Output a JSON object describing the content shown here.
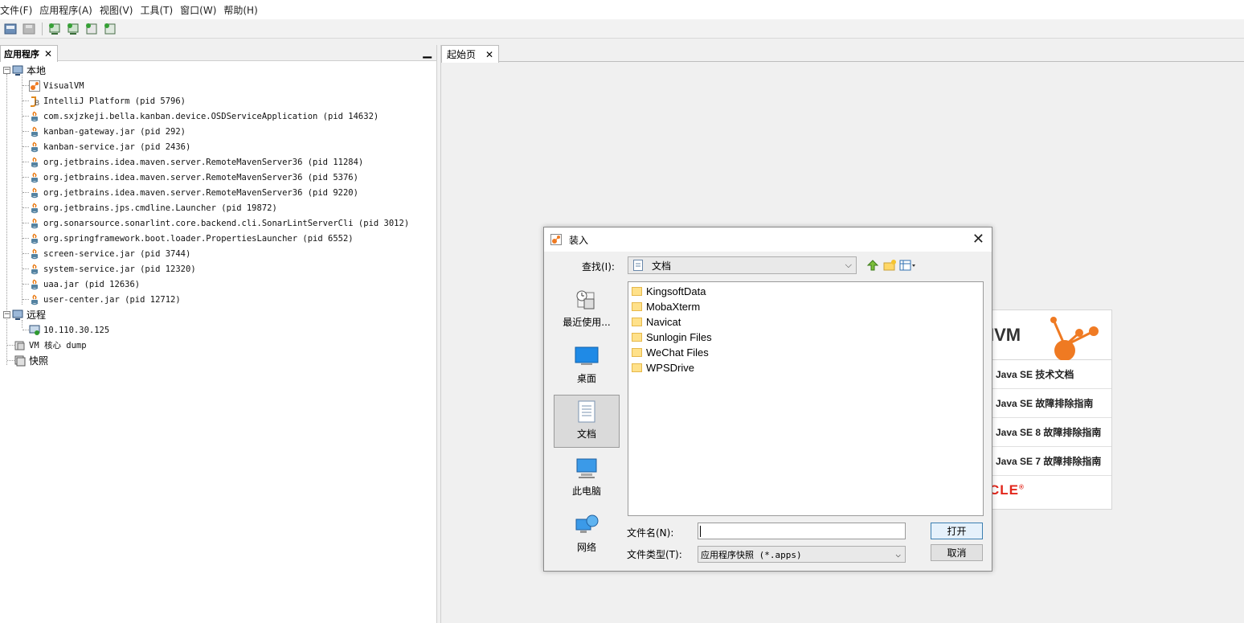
{
  "menubar": {
    "items": [
      "文件(F)",
      "应用程序(A)",
      "视图(V)",
      "工具(T)",
      "窗口(W)",
      "帮助(H)"
    ]
  },
  "toolbar": {
    "icons": [
      "open-icon",
      "save-icon",
      "add-jmx-icon",
      "add-remote-icon",
      "add-coredump-icon",
      "add-snapshot-icon"
    ]
  },
  "left_panel": {
    "tab_label": "应用程序",
    "close_glyph": "✕",
    "minimize_glyph": "▁",
    "tree": {
      "local_label": "本地",
      "local_items": [
        {
          "label": "VisualVM",
          "icon": "visualvm-icon"
        },
        {
          "label": "IntelliJ Platform (pid 5796)",
          "icon": "intellij-icon"
        },
        {
          "label": "com.sxjzkeji.bella.kanban.device.OSDServiceApplication (pid 14632)",
          "icon": "java-icon"
        },
        {
          "label": "kanban-gateway.jar (pid 292)",
          "icon": "java-icon"
        },
        {
          "label": "kanban-service.jar (pid 2436)",
          "icon": "java-icon"
        },
        {
          "label": "org.jetbrains.idea.maven.server.RemoteMavenServer36 (pid 11284)",
          "icon": "java-icon"
        },
        {
          "label": "org.jetbrains.idea.maven.server.RemoteMavenServer36 (pid 5376)",
          "icon": "java-icon"
        },
        {
          "label": "org.jetbrains.idea.maven.server.RemoteMavenServer36 (pid 9220)",
          "icon": "java-icon"
        },
        {
          "label": "org.jetbrains.jps.cmdline.Launcher (pid 19872)",
          "icon": "java-icon"
        },
        {
          "label": "org.sonarsource.sonarlint.core.backend.cli.SonarLintServerCli (pid 3012)",
          "icon": "java-icon"
        },
        {
          "label": "org.springframework.boot.loader.PropertiesLauncher (pid 6552)",
          "icon": "java-icon"
        },
        {
          "label": "screen-service.jar (pid 3744)",
          "icon": "java-icon"
        },
        {
          "label": "system-service.jar (pid 12320)",
          "icon": "java-icon"
        },
        {
          "label": "uaa.jar (pid 12636)",
          "icon": "java-icon"
        },
        {
          "label": "user-center.jar (pid 12712)",
          "icon": "java-icon"
        }
      ],
      "remote_label": "远程",
      "remote_items": [
        {
          "label": "10.110.30.125",
          "icon": "remote-host-icon"
        }
      ],
      "coredump_label": "VM 核心 dump",
      "snapshot_label": "快照"
    }
  },
  "right_panel": {
    "tab_label": "起始页",
    "close_glyph": "✕",
    "start_card": {
      "logo_text": "IVM",
      "links": [
        "Java SE 技术文档",
        "Java SE 故障排除指南",
        "Java SE 8 故障排除指南",
        "Java SE 7 故障排除指南"
      ],
      "oracle_text": "CLE",
      "oracle_mark": "®"
    }
  },
  "dialog": {
    "title": "装入",
    "close_glyph": "✕",
    "look_in_label": "查找(I):",
    "look_in_value": "文档",
    "places": [
      {
        "label": "最近使用...",
        "icon": "recent-icon",
        "selected": false
      },
      {
        "label": "桌面",
        "icon": "desktop-icon",
        "selected": false
      },
      {
        "label": "文档",
        "icon": "documents-icon",
        "selected": true
      },
      {
        "label": "此电脑",
        "icon": "computer-icon",
        "selected": false
      },
      {
        "label": "网络",
        "icon": "network-icon",
        "selected": false
      }
    ],
    "files": [
      "KingsoftData",
      "MobaXterm",
      "Navicat",
      "Sunlogin Files",
      "WeChat Files",
      "WPSDrive"
    ],
    "filename_label": "文件名(N):",
    "filename_value": "",
    "filetype_label": "文件类型(T):",
    "filetype_value": "应用程序快照 (*.apps)",
    "open_button": "打开",
    "cancel_button": "取消",
    "combo_arrow": "⌵"
  }
}
